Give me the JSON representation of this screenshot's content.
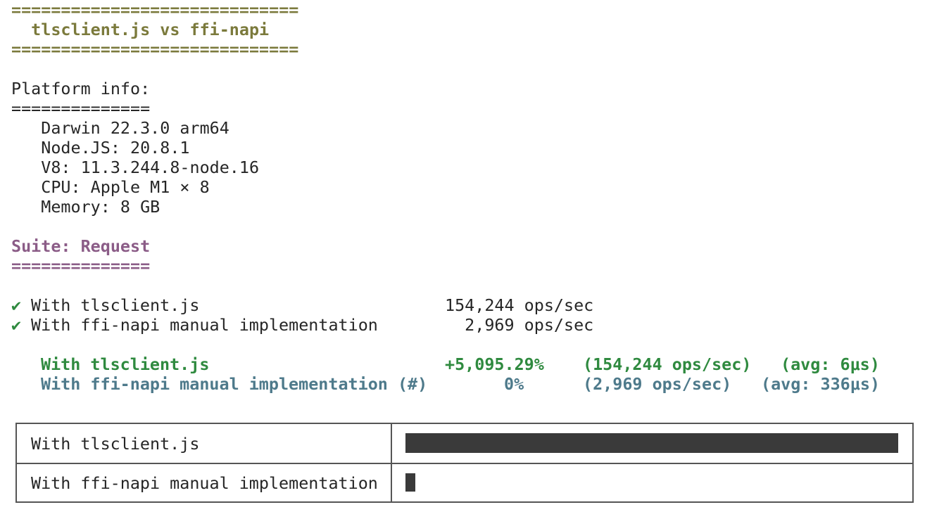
{
  "header": {
    "rule": "=============================",
    "title": "  tlsclient.js vs ffi-napi"
  },
  "platform": {
    "heading": "Platform info:",
    "rule": "==============",
    "lines": [
      "   Darwin 22.3.0 arm64",
      "   Node.JS: 20.8.1",
      "   V8: 11.3.244.8-node.16",
      "   CPU: Apple M1 × 8",
      "   Memory: 8 GB"
    ]
  },
  "suite": {
    "heading": "Suite: Request",
    "rule": "=============="
  },
  "results": [
    {
      "mark": "✔",
      "name": "With tlsclient.js",
      "ops": "154,244 ops/sec"
    },
    {
      "mark": "✔",
      "name": "With ffi-napi manual implementation",
      "ops": "  2,969 ops/sec"
    }
  ],
  "summary": [
    {
      "name": "With tlsclient.js",
      "percent": "+5,095.29%",
      "ops": "(154,244 ops/sec)",
      "avg": "(avg: 6μs)",
      "status_color": "#2f8a3f"
    },
    {
      "name": "With ffi-napi manual implementation (#)",
      "percent": "0%",
      "ops": "(2,969 ops/sec)",
      "avg": "(avg: 336μs)",
      "status_color": "#4e7a8b"
    }
  ],
  "bar_table": [
    {
      "label": "With tlsclient.js",
      "fraction": 1.0
    },
    {
      "label": "With ffi-napi manual implementation",
      "fraction": 0.0193
    }
  ]
}
